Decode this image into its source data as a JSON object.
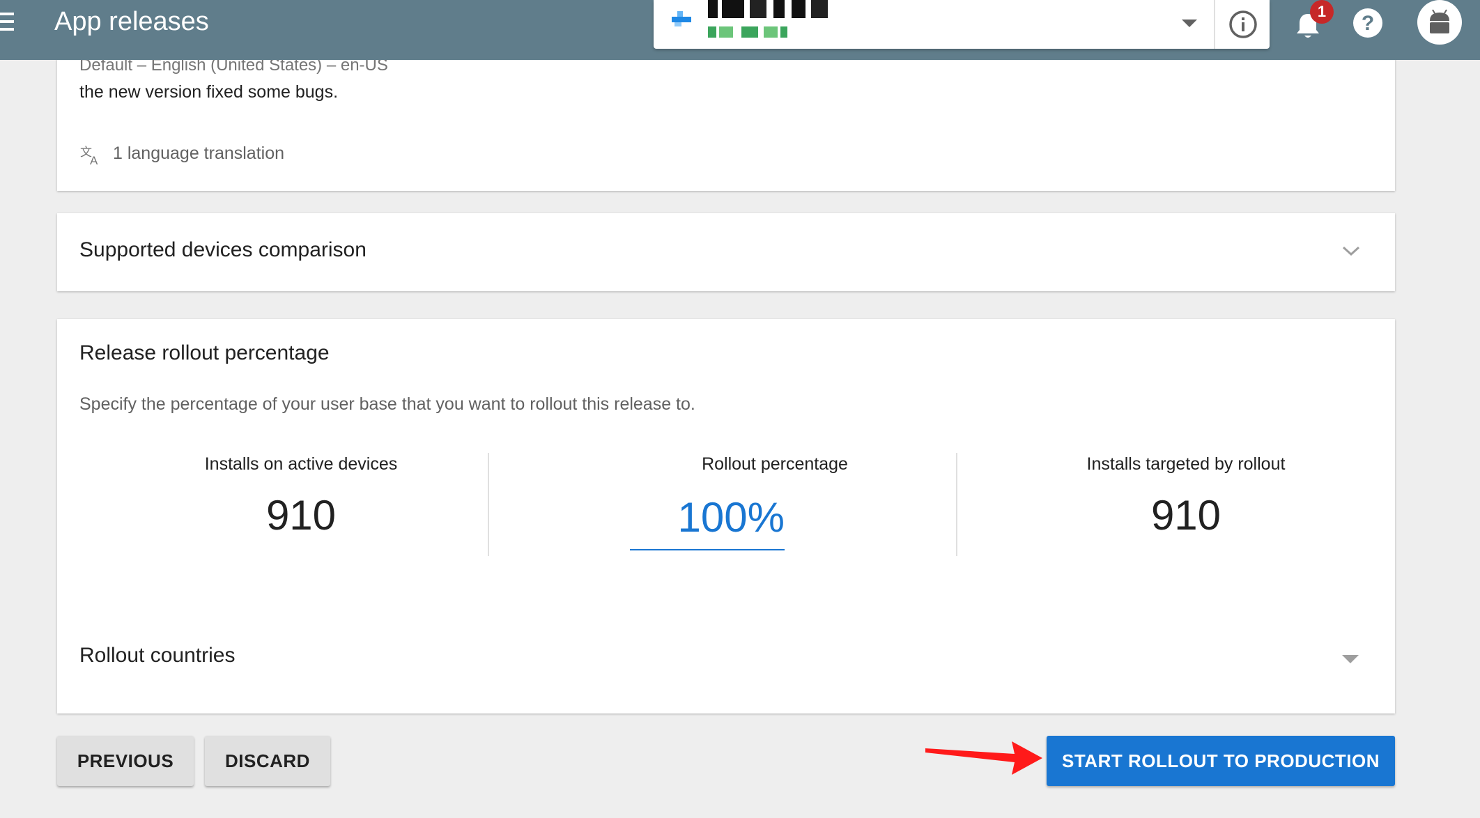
{
  "header": {
    "title": "App releases",
    "notification_count": "1",
    "menu_icon": "menu-icon",
    "info_icon": "info-icon",
    "bell_icon": "bell-icon",
    "help_icon": "help-icon",
    "avatar_icon": "android-avatar-icon",
    "color": "#607d8b"
  },
  "release_notes": {
    "language": "Default – English (United States) – en-US",
    "text": "the new version fixed some bugs.",
    "translations": "1 language translation"
  },
  "supported_devices": {
    "title": "Supported devices comparison"
  },
  "rollout": {
    "title": "Release rollout percentage",
    "description": "Specify the percentage of your user base that you want to rollout this release to.",
    "installs_active_label": "Installs on active devices",
    "installs_active_value": "910",
    "percentage_label": "Rollout percentage",
    "percentage_value": "100%",
    "targeted_label": "Installs targeted by rollout",
    "targeted_value": "910",
    "countries_label": "Rollout countries",
    "accent": "#1976d2"
  },
  "actions": {
    "previous": "PREVIOUS",
    "discard": "DISCARD",
    "start": "START ROLLOUT TO PRODUCTION",
    "annotation_color": "#ff1a1a"
  }
}
